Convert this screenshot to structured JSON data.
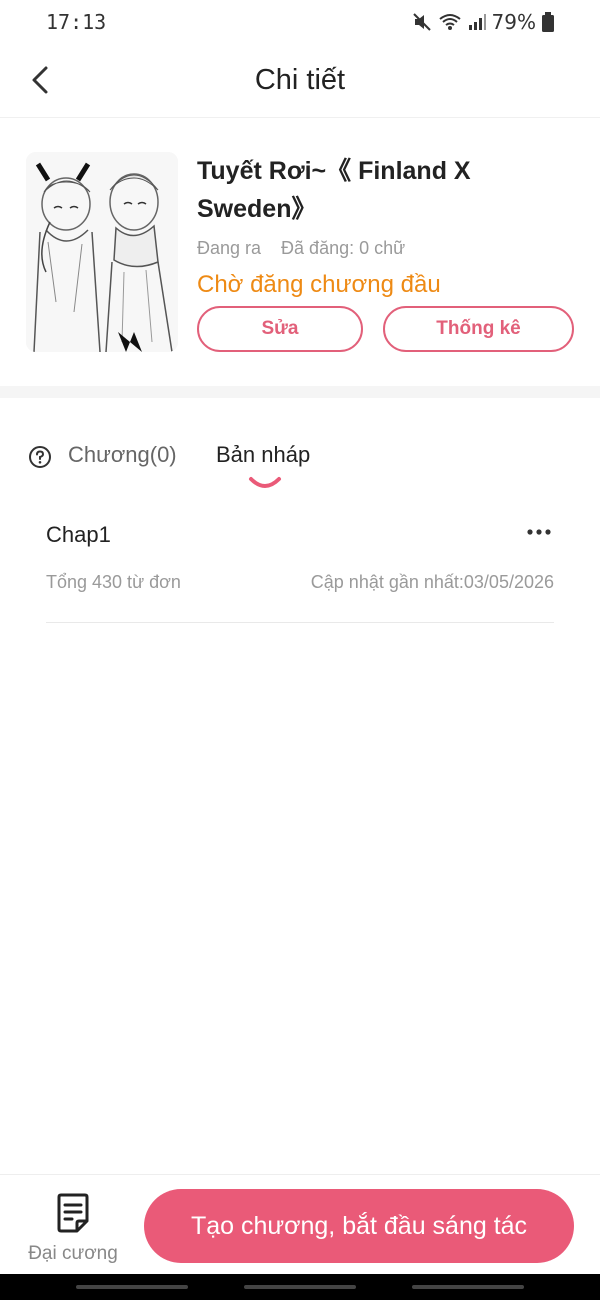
{
  "status_bar": {
    "time": "17:13",
    "battery": "79%",
    "icons": [
      "mute-icon",
      "wifi-icon",
      "signal-icon",
      "battery-icon"
    ]
  },
  "header": {
    "title": "Chi tiết",
    "back_icon": "chevron-left-icon"
  },
  "book": {
    "title": "Tuyết Rơi~《 Finland X Sweden》",
    "status": "Đang ra",
    "published": "Đã đăng: 0 chữ",
    "pending_text": "Chờ đăng chương đầu",
    "edit_label": "Sửa",
    "stats_label": "Thống kê"
  },
  "tabs": {
    "chapters_label": "Chương(0)",
    "drafts_label": "Bản nháp",
    "active": "drafts"
  },
  "drafts": [
    {
      "title": "Chap1",
      "words": "Tổng 430 từ đơn",
      "updated": "Cập nhật gần nhất:03/05/2026"
    }
  ],
  "bottom_bar": {
    "outline_label": "Đại cương",
    "create_label": "Tạo chương, bắt đầu sáng tác"
  },
  "colors": {
    "accent": "#ea5a78",
    "pending": "#ee8a14",
    "muted_text": "#9a9a9a"
  }
}
